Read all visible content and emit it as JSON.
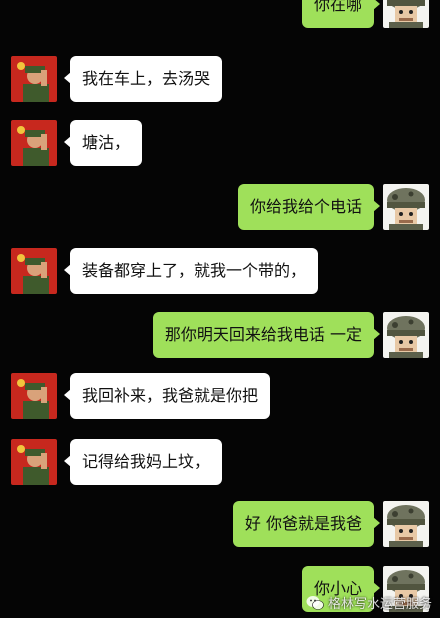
{
  "colors": {
    "background": "#050505",
    "incoming_bubble": "#ffffff",
    "outgoing_bubble": "#9fe05a"
  },
  "icons": {
    "incoming_avatar": "soldier-saluting-avatar",
    "outgoing_avatar": "cartoon-soldier-helmet-avatar",
    "watermark": "wechat-icon"
  },
  "messages": [
    {
      "side": "outgoing",
      "text": "你在哪"
    },
    {
      "side": "incoming",
      "text": "我在车上，去汤哭"
    },
    {
      "side": "incoming",
      "text": "塘沽，"
    },
    {
      "side": "outgoing",
      "text": "你给我给个电话"
    },
    {
      "side": "incoming",
      "text": "装备都穿上了，就我一个带的，"
    },
    {
      "side": "outgoing",
      "text": "那你明天回来给我电话 一定"
    },
    {
      "side": "incoming",
      "text": "我回补来，我爸就是你把"
    },
    {
      "side": "incoming",
      "text": "记得给我妈上坟，"
    },
    {
      "side": "outgoing",
      "text": "好 你爸就是我爸"
    },
    {
      "side": "outgoing",
      "text": "你小心"
    }
  ],
  "watermark": {
    "text": "格林写水运营服务"
  }
}
